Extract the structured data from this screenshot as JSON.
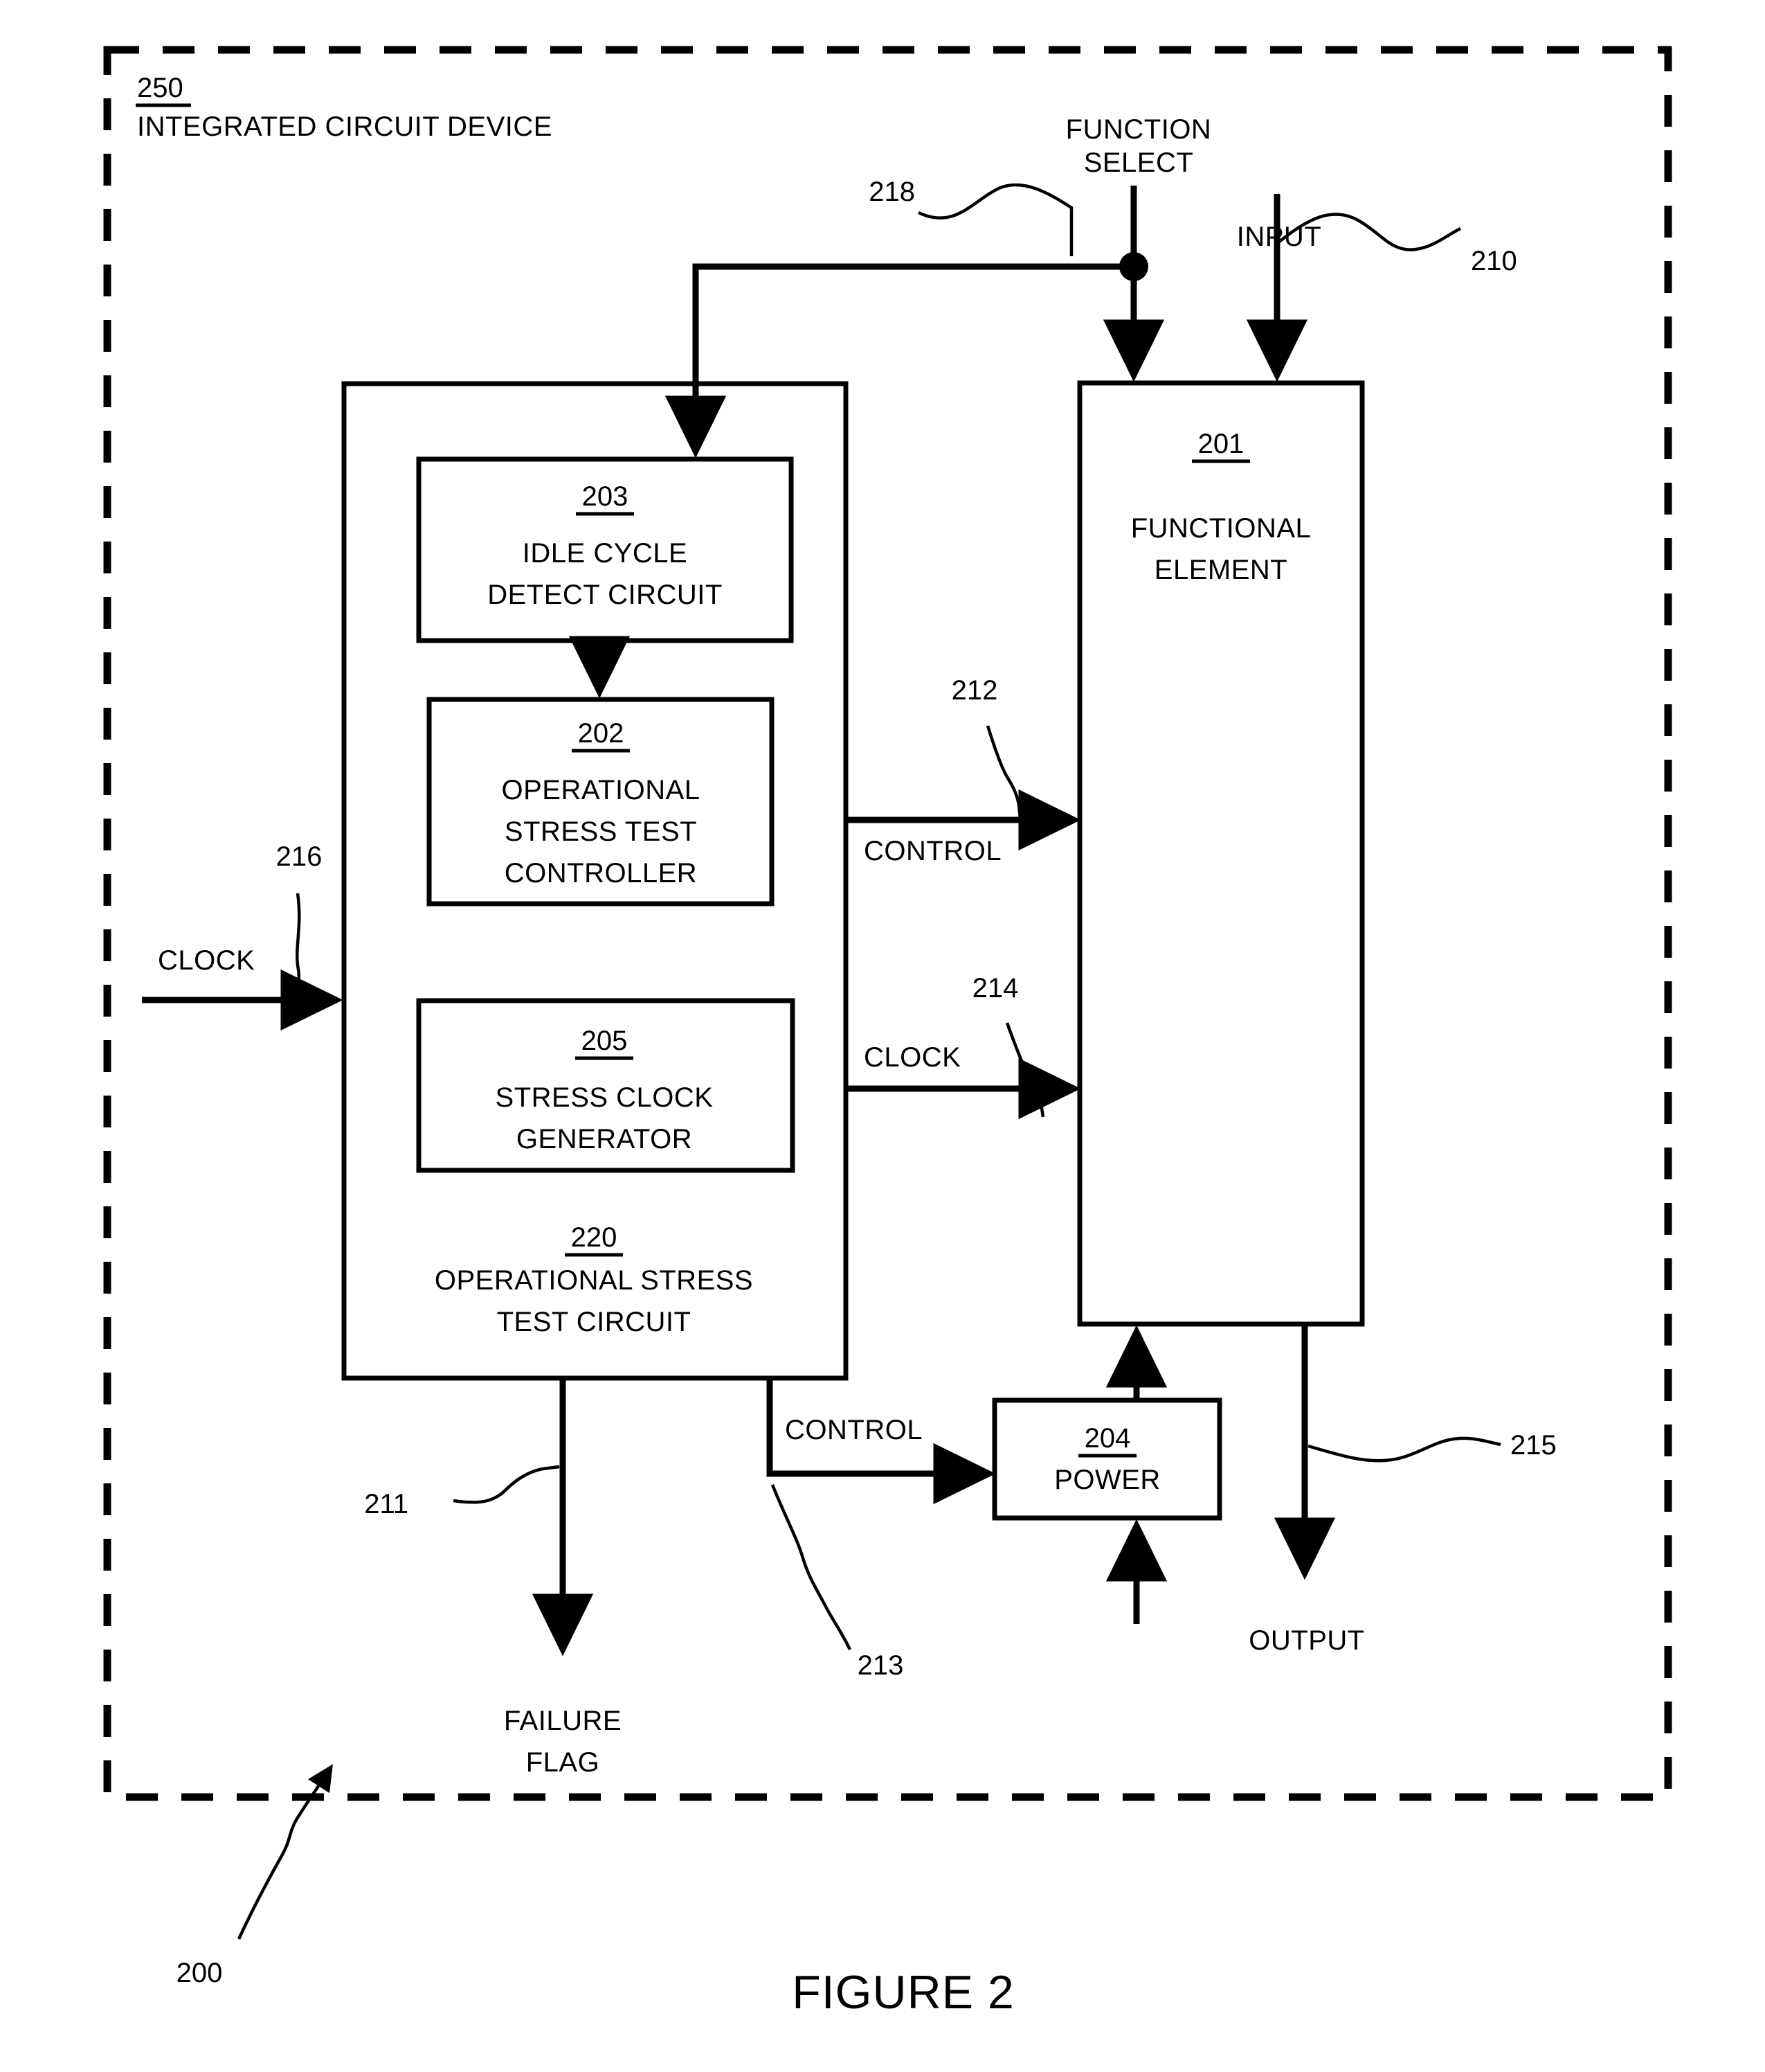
{
  "figure": {
    "title": "FIGURE 2",
    "overall_ref": "200"
  },
  "device": {
    "ref": "250",
    "name": "INTEGRATED CIRCUIT DEVICE"
  },
  "blocks": [
    {
      "ref": "201",
      "name_line1": "FUNCTIONAL",
      "name_line2": "ELEMENT"
    },
    {
      "ref": "203",
      "name_line1": "IDLE CYCLE",
      "name_line2": "DETECT CIRCUIT"
    },
    {
      "ref": "202",
      "name_line1": "OPERATIONAL",
      "name_line2": "STRESS TEST",
      "name_line3": "CONTROLLER"
    },
    {
      "ref": "205",
      "name_line1": "STRESS CLOCK",
      "name_line2": "GENERATOR"
    },
    {
      "ref": "220",
      "name_line1": "OPERATIONAL STRESS",
      "name_line2": "TEST CIRCUIT"
    },
    {
      "ref": "204",
      "name_line1": "POWER"
    }
  ],
  "signals": {
    "function_select": {
      "label_line1": "FUNCTION",
      "label_line2": "SELECT",
      "ref": "218"
    },
    "input": {
      "label": "INPUT",
      "ref": "210"
    },
    "clock_in": {
      "label": "CLOCK",
      "ref": "216"
    },
    "control_to_fe": {
      "label": "CONTROL",
      "ref": "212"
    },
    "clock_to_fe": {
      "label": "CLOCK",
      "ref": "214"
    },
    "control_to_power": {
      "label": "CONTROL",
      "ref": "213"
    },
    "failure_flag": {
      "label_line1": "FAILURE",
      "label_line2": "FLAG",
      "ref": "211"
    },
    "output": {
      "label": "OUTPUT",
      "ref": "215"
    }
  },
  "colors": {
    "ink": "#000000",
    "paper": "#ffffff"
  }
}
